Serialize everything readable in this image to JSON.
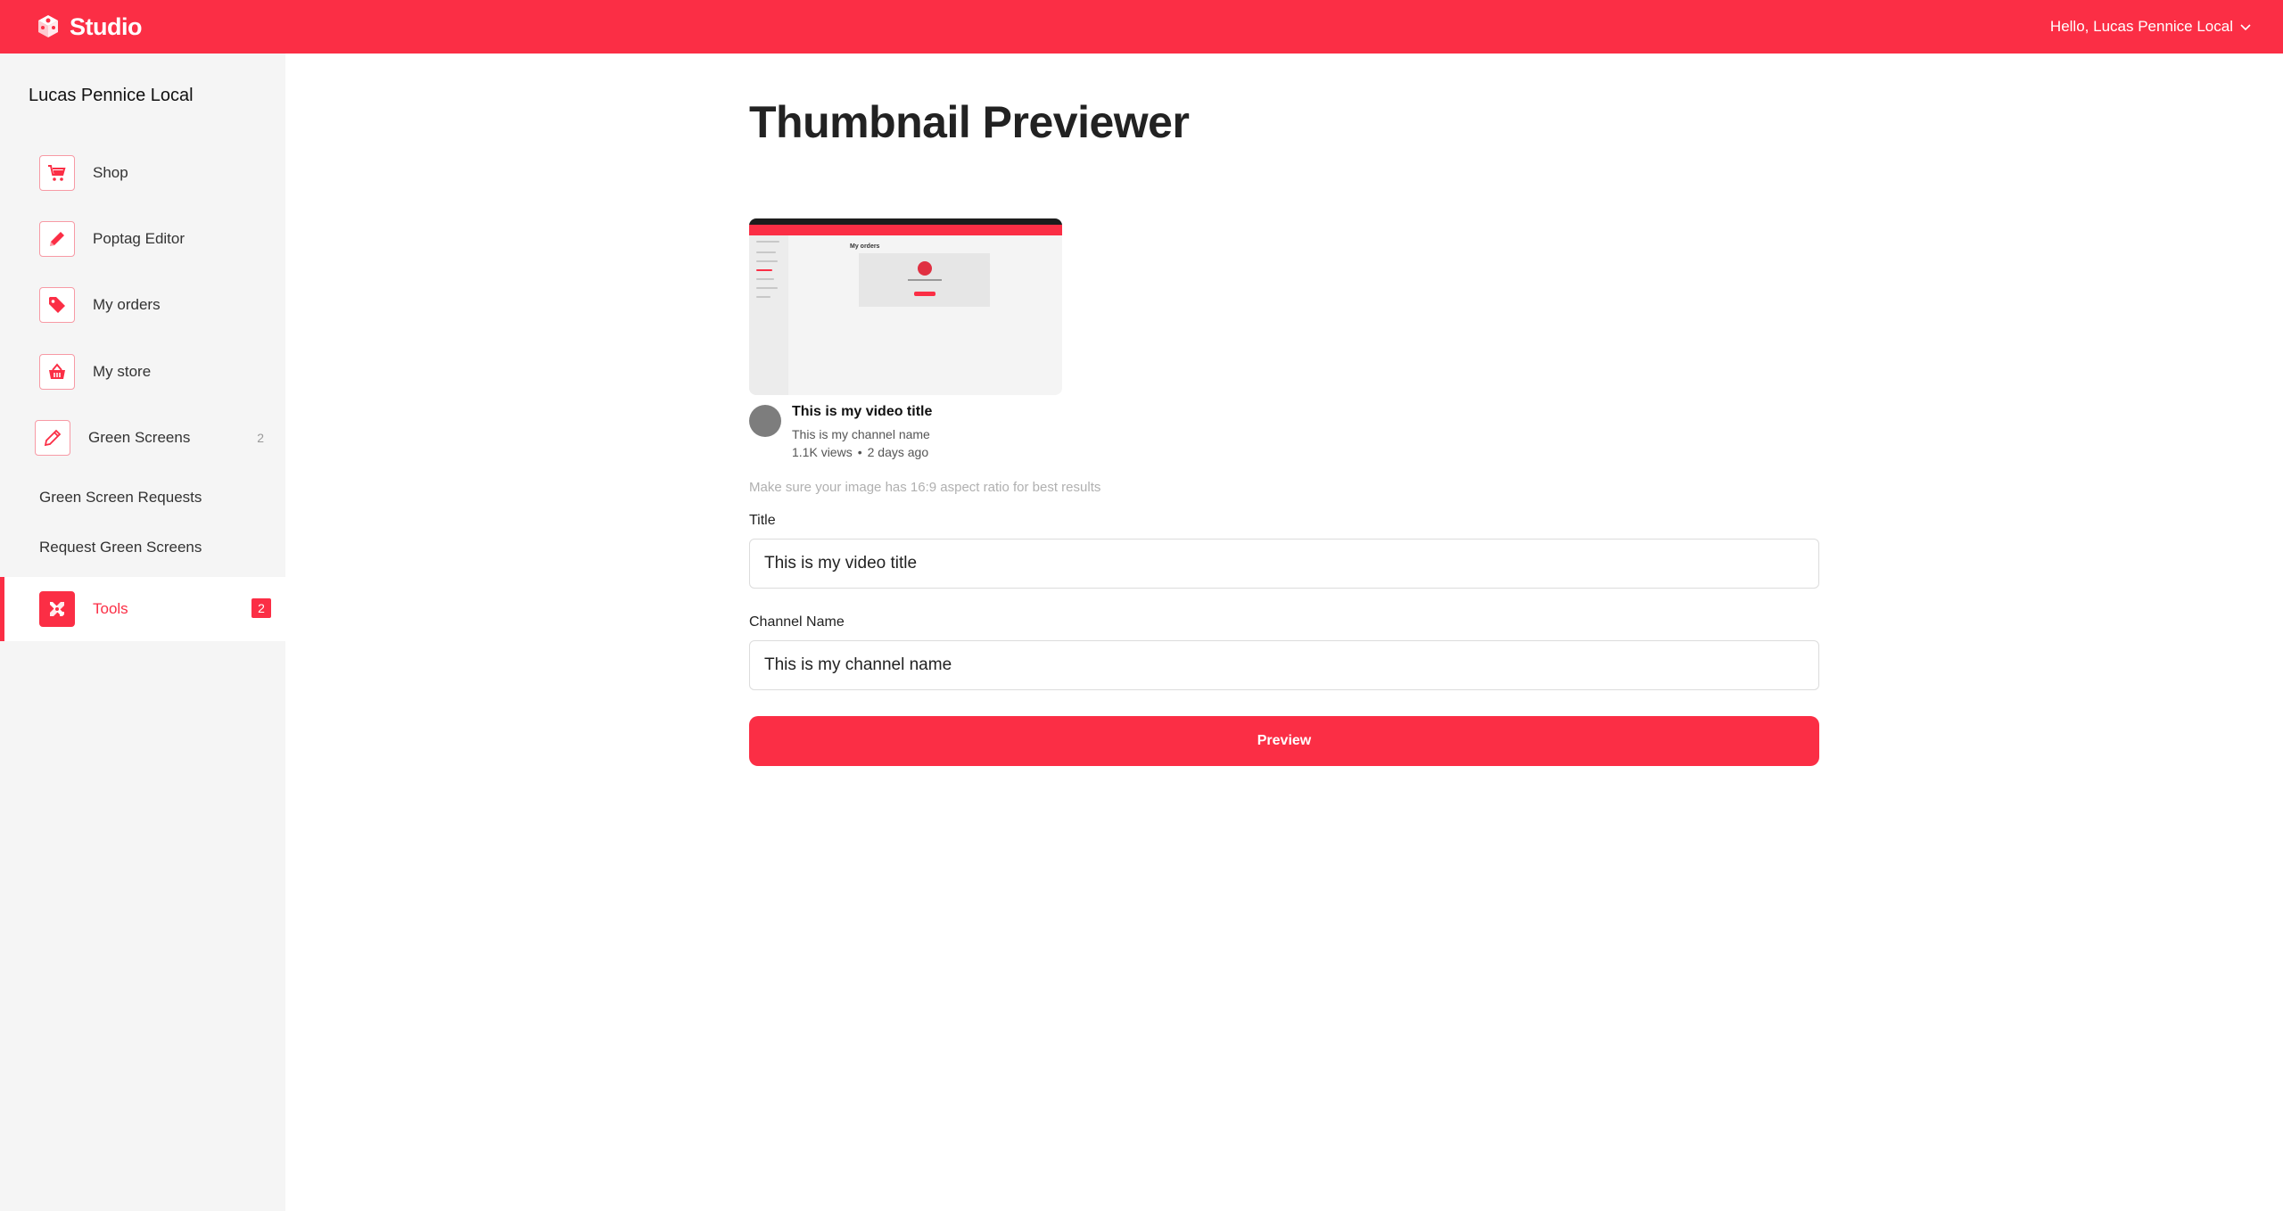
{
  "app": {
    "brand_name": "Studio",
    "brand_color": "#fb2e45",
    "user_greeting": "Hello, Lucas Pennice Local"
  },
  "sidebar": {
    "account_name": "Lucas Pennice Local",
    "items": [
      {
        "label": "Shop",
        "icon": "cart-icon"
      },
      {
        "label": "Poptag Editor",
        "icon": "pencil-icon"
      },
      {
        "label": "My orders",
        "icon": "tag-icon"
      },
      {
        "label": "My store",
        "icon": "basket-icon"
      },
      {
        "label": "Green Screens",
        "icon": "pencil-icon",
        "count": "2"
      }
    ],
    "subitems": [
      {
        "label": "Green Screen Requests"
      },
      {
        "label": "Request Green Screens"
      }
    ],
    "active_item": {
      "label": "Tools",
      "icon": "tools-icon",
      "badge": "2"
    }
  },
  "main": {
    "page_title": "Thumbnail Previewer",
    "thumbnail": {
      "inner_heading": "My orders"
    },
    "preview_card": {
      "video_title": "This is my video title",
      "channel_name": "This is my channel name",
      "views": "1.1K views",
      "separator": "•",
      "age": "2 days ago"
    },
    "hint": "Make sure your image has 16:9 aspect ratio for best results",
    "form": {
      "title_label": "Title",
      "title_value": "This is my video title",
      "channel_label": "Channel Name",
      "channel_value": "This is my channel name",
      "submit_label": "Preview"
    }
  }
}
